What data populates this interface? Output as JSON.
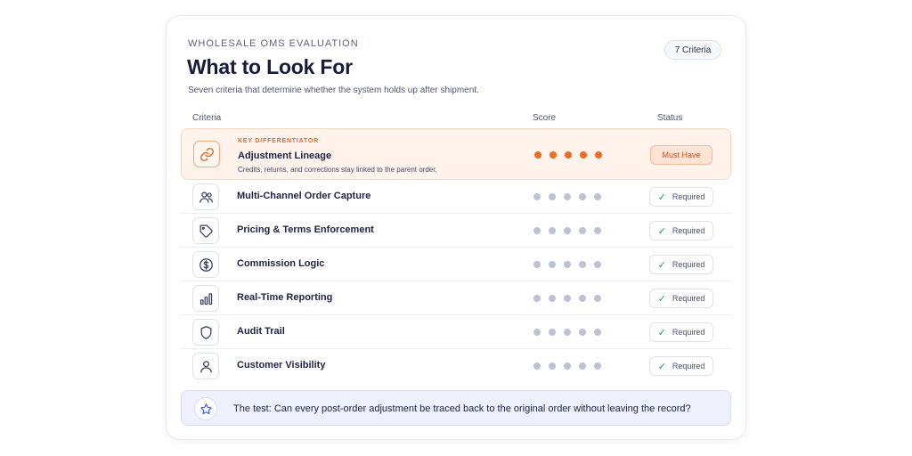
{
  "header": {
    "eyebrow": "WHOLESALE OMS EVALUATION",
    "title": "What to Look For",
    "subtitle": "Seven criteria that determine whether the system holds up after shipment.",
    "badge": "7 Criteria"
  },
  "columns": {
    "criteria": "Criteria",
    "score": "Score",
    "status": "Status"
  },
  "rows": [
    {
      "tag": "KEY DIFFERENTIATOR",
      "name": "Adjustment Lineage",
      "description": "Credits, returns, and corrections stay linked to the parent order.",
      "icon": "link-icon",
      "score": 5,
      "status": "Must Have",
      "highlight": true
    },
    {
      "name": "Multi-Channel Order Capture",
      "icon": "users-icon",
      "score": 0,
      "status": "Required"
    },
    {
      "name": "Pricing & Terms Enforcement",
      "icon": "tag-icon",
      "score": 0,
      "status": "Required"
    },
    {
      "name": "Commission Logic",
      "icon": "dollar-icon",
      "score": 0,
      "status": "Required"
    },
    {
      "name": "Real-Time Reporting",
      "icon": "bar-chart-icon",
      "score": 0,
      "status": "Required"
    },
    {
      "name": "Audit Trail",
      "icon": "shield-icon",
      "score": 0,
      "status": "Required"
    },
    {
      "name": "Customer Visibility",
      "icon": "user-icon",
      "score": 0,
      "status": "Required"
    }
  ],
  "footer": {
    "icon": "star-icon",
    "text": "The test: Can every post-order adjustment be traced back to the original order without leaving the record?"
  },
  "colors": {
    "accent": "#ee6b22",
    "dot_inactive": "#bcc2d3",
    "check": "#1f9d4b"
  }
}
